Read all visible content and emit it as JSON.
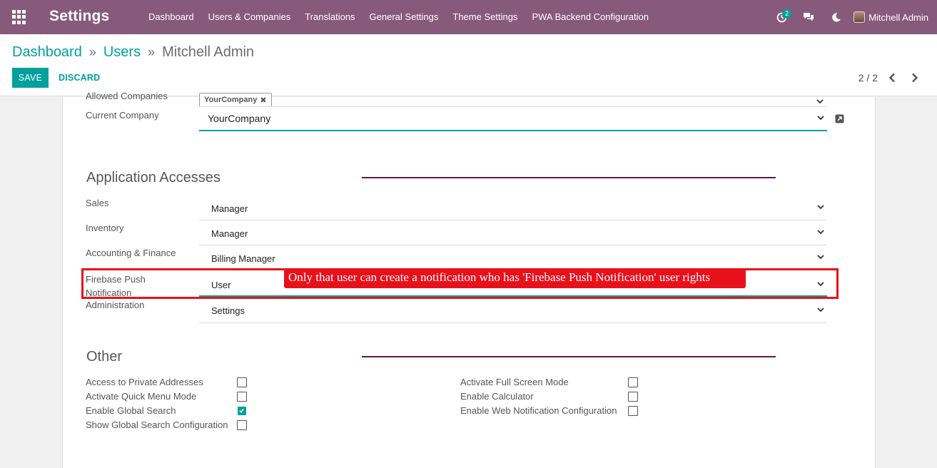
{
  "navbar": {
    "app_title": "Settings",
    "menu": [
      "Dashboard",
      "Users & Companies",
      "Translations",
      "General Settings",
      "Theme Settings",
      "PWA Backend Configuration"
    ],
    "activity_count": "2",
    "user_name": "Mitchell Admin",
    "color": "#875a7b"
  },
  "breadcrumb": {
    "first": "Dashboard",
    "second": "Users",
    "current": "Mitchell Admin",
    "separator": "»"
  },
  "actions": {
    "save": "SAVE",
    "discard": "DISCARD"
  },
  "pager": {
    "text": "2 / 2"
  },
  "form": {
    "allowed_companies_label": "Allowed Companies",
    "allowed_company_tag": "YourCompany",
    "current_company_label": "Current Company",
    "current_company_value": "YourCompany",
    "app_access_title": "Application Accesses",
    "fields": [
      {
        "label": "Sales",
        "value": "Manager"
      },
      {
        "label": "Inventory",
        "value": "Manager"
      },
      {
        "label": "Accounting & Finance",
        "value": "Billing Manager"
      },
      {
        "label": "Firebase Push Notification",
        "value": "User"
      },
      {
        "label": "Administration",
        "value": "Settings"
      }
    ],
    "other_title": "Other",
    "checkboxes_left": [
      {
        "label": "Access to Private Addresses",
        "checked": false
      },
      {
        "label": "Activate Quick Menu Mode",
        "checked": false
      },
      {
        "label": "Enable Global Search",
        "checked": true
      },
      {
        "label": "Show Global Search Configuration",
        "checked": false
      }
    ],
    "checkboxes_right": [
      {
        "label": "Activate Full Screen Mode",
        "checked": false
      },
      {
        "label": "Enable Calculator",
        "checked": false
      },
      {
        "label": "Enable Web Notification Configuration",
        "checked": false
      }
    ]
  },
  "annotation": {
    "text": "Only that user can create a notification who has 'Firebase Push Notification' user rights",
    "color": "#e8111b"
  },
  "colors": {
    "accent": "#00a09d",
    "section_line": "#5c1a4a"
  }
}
